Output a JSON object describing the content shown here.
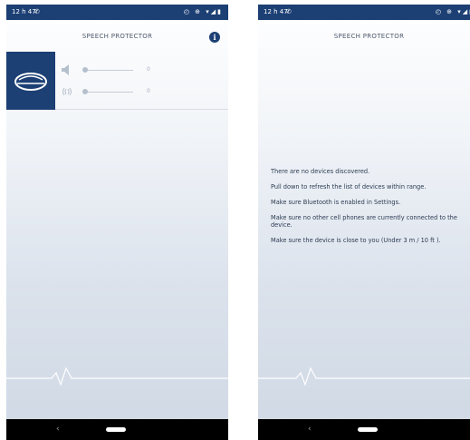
{
  "status_bar": {
    "time": "12 h 47",
    "notification_glyph": "✆",
    "system_icons": "◴ ⊕ ▾◢▮"
  },
  "header": {
    "title": "SPEECH PROTECTOR",
    "info_glyph": "i"
  },
  "device": {
    "icon": "device-icon",
    "rows": [
      {
        "icon": "speaker-icon",
        "value": "0"
      },
      {
        "icon": "sound-waves-icon",
        "value": "0"
      }
    ]
  },
  "empty_state": {
    "lines": [
      "There are no devices discovered.",
      "Pull down to refresh the list of devices within range.",
      "Make sure Bluetooth is enabled in Settings.",
      "Make sure no other cell phones are currently connected to the device.",
      "Make sure the device is close to you (Under 3 m / 10 ft )."
    ]
  },
  "nav": {
    "back_glyph": "‹"
  },
  "colors": {
    "brand": "#1c3f74",
    "background_top": "#ffffff",
    "background_bottom": "#cfd8e4",
    "text": "#2b3b52"
  }
}
